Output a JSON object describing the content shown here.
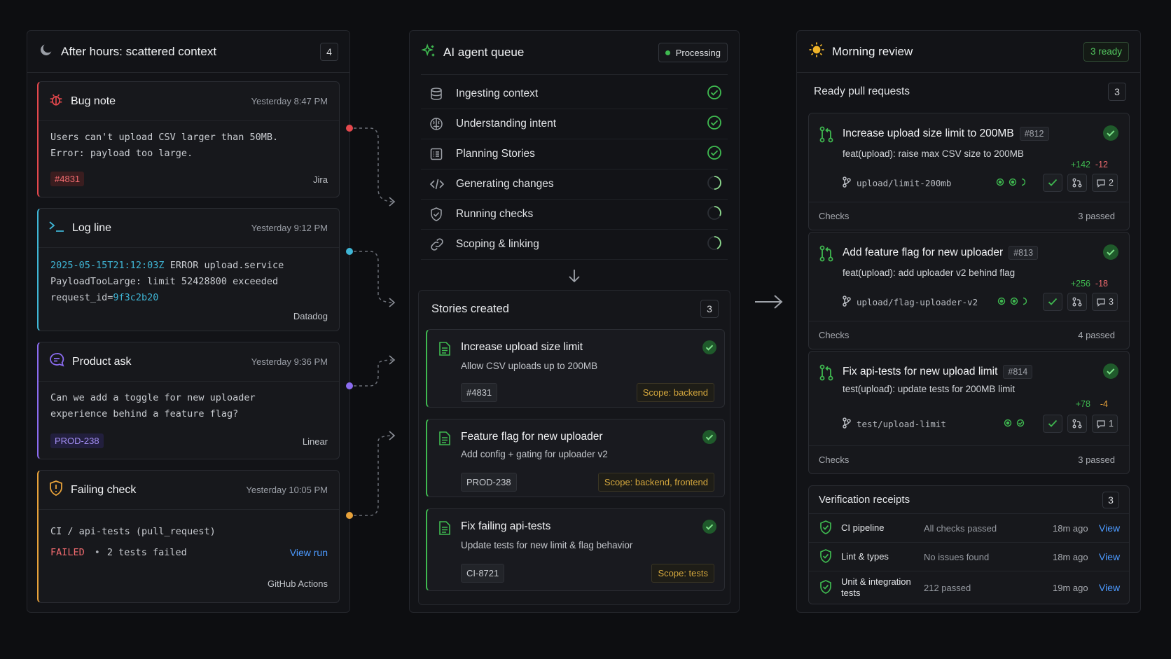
{
  "left": {
    "title": "After hours: scattered context",
    "count": "4",
    "cards": [
      {
        "name": "Bug note",
        "time": "Yesterday 8:47 PM",
        "lines": [
          "Users can't upload CSV larger than 50MB.",
          "Error: payload too large."
        ],
        "tag": "#4831",
        "source": "Jira",
        "accent": "#e5484d"
      },
      {
        "name": "Log line",
        "time": "Yesterday 9:12 PM",
        "log_ts": "2025-05-15T21:12:03Z",
        "log_rest": " ERROR upload.service",
        "log_line2": "PayloadTooLarge: limit 52428800 exceeded",
        "log_reqkey": "request_id=",
        "log_reqval": "9f3c2b20",
        "source": "Datadog",
        "accent": "#3fb6d6"
      },
      {
        "name": "Product ask",
        "time": "Yesterday 9:36 PM",
        "lines": [
          "Can we add a toggle for new uploader",
          "experience behind a feature flag?"
        ],
        "tag": "PROD-238",
        "source": "Linear",
        "accent": "#8b6cf0"
      },
      {
        "name": "Failing check",
        "time": "Yesterday 10:05 PM",
        "line1": "CI / api-tests (pull_request)",
        "failed": "FAILED",
        "sep": "•",
        "tests_failed": "2 tests failed",
        "view_run": "View run",
        "source": "GitHub Actions",
        "accent": "#e8a23a"
      }
    ]
  },
  "mid": {
    "title": "AI agent queue",
    "status": "Processing",
    "steps": [
      {
        "label": "Ingesting context",
        "icon": "database-icon",
        "done": true
      },
      {
        "label": "Understanding intent",
        "icon": "brain-icon",
        "done": true
      },
      {
        "label": "Planning Stories",
        "icon": "list-icon",
        "done": true
      },
      {
        "label": "Generating changes",
        "icon": "code-icon",
        "done": false
      },
      {
        "label": "Running checks",
        "icon": "shield-icon",
        "done": false
      },
      {
        "label": "Scoping & linking",
        "icon": "link-icon",
        "done": false
      }
    ],
    "stories_title": "Stories created",
    "stories_count": "3",
    "stories": [
      {
        "title": "Increase upload size limit",
        "desc": "Allow CSV uploads up to 200MB",
        "id": "#4831",
        "scope": "Scope:  backend"
      },
      {
        "title": "Feature flag for new uploader",
        "desc": "Add config + gating for uploader v2",
        "id": "PROD-238",
        "scope": "Scope:  backend, frontend"
      },
      {
        "title": "Fix failing api-tests",
        "desc": "Update tests for new limit & flag behavior",
        "id": "CI-8721",
        "scope": "Scope:  tests"
      }
    ]
  },
  "right": {
    "title": "Morning review",
    "ready": "3 ready",
    "prs_title": "Ready pull requests",
    "prs_count": "3",
    "prs": [
      {
        "title": "Increase upload size limit to 200MB",
        "num": "#812",
        "desc": "feat(upload): raise max CSV size to 200MB",
        "add": "+142",
        "del": "-12",
        "branch": "upload/limit-200mb",
        "comments": "2",
        "checks_label": "Checks",
        "checks": "3 passed"
      },
      {
        "title": "Add feature flag for new uploader",
        "num": "#813",
        "desc": "feat(upload): add uploader v2 behind flag",
        "add": "+256",
        "del": "-18",
        "branch": "upload/flag-uploader-v2",
        "comments": "3",
        "checks_label": "Checks",
        "checks": "4 passed"
      },
      {
        "title": "Fix api-tests for new upload limit",
        "num": "#814",
        "desc": "test(upload): update tests for 200MB limit",
        "add": "+78",
        "del": "-4",
        "branch": "test/upload-limit",
        "comments": "1",
        "checks_label": "Checks",
        "checks": "3 passed"
      }
    ],
    "verif_title": "Verification receipts",
    "verif_count": "3",
    "receipts": [
      {
        "name": "CI pipeline",
        "status": "All checks passed",
        "ago": "18m ago",
        "view": "View"
      },
      {
        "name": "Lint & types",
        "status": "No issues found",
        "ago": "18m ago",
        "view": "View"
      },
      {
        "name": "Unit & integration tests",
        "status": "212 passed",
        "ago": "19m ago",
        "view": "View"
      }
    ]
  },
  "colors": {
    "green": "#3fb950",
    "blue": "#4c9aff",
    "red": "#e5484d",
    "amber": "#d4a73d"
  }
}
